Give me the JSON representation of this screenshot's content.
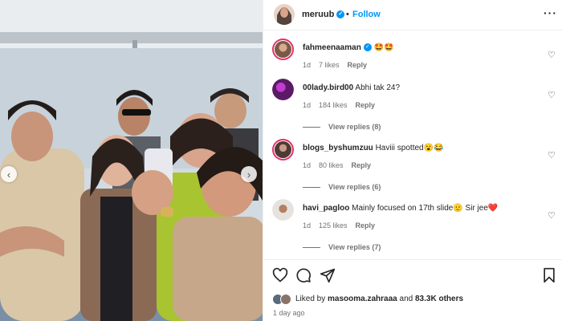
{
  "post": {
    "username": "meruub",
    "dot": "•",
    "follow_label": "Follow",
    "more_label": "···"
  },
  "media": {
    "nav_prev": "‹",
    "nav_next": "›"
  },
  "comments": [
    {
      "username": "fahmeenaaman",
      "verified": true,
      "text": "🤩🤩",
      "time": "1d",
      "likes": "7 likes",
      "reply": "Reply",
      "view_replies": ""
    },
    {
      "username": "00lady.bird00",
      "verified": false,
      "text": "Abhi tak 24?",
      "time": "1d",
      "likes": "184 likes",
      "reply": "Reply",
      "view_replies": "View replies (8)"
    },
    {
      "username": "blogs_byshumzuu",
      "verified": false,
      "text": "Haviii spotted😮😂",
      "time": "1d",
      "likes": "80 likes",
      "reply": "Reply",
      "view_replies": "View replies (6)"
    },
    {
      "username": "havi_pagloo",
      "verified": false,
      "text": "Mainly focused on 17th slide🫡 Sir jee❤️",
      "time": "1d",
      "likes": "125 likes",
      "reply": "Reply",
      "view_replies": "View replies (7)"
    }
  ],
  "likes": {
    "prefix": "Liked by",
    "user": "masooma.zahraaa",
    "middle": "and",
    "others": "83.3K others"
  },
  "time_ago": "1 day ago",
  "icons": {
    "verified": "✓",
    "heart": "♡",
    "like_button": "heart-icon",
    "comment_button": "comment-icon",
    "share_button": "share-icon",
    "save_button": "bookmark-icon"
  },
  "colors": {
    "link_blue": "#0095f6",
    "muted_text": "#737373",
    "story_ring": "#e1306c"
  }
}
